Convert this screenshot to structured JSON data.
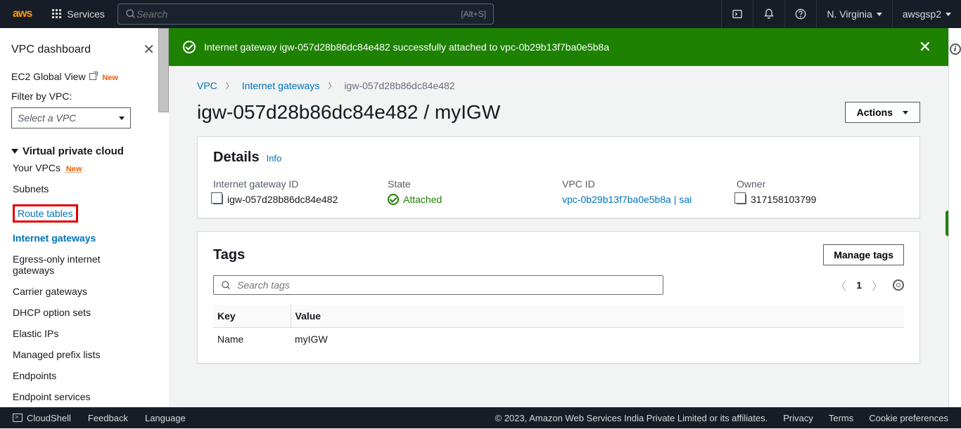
{
  "topnav": {
    "logo": "aws",
    "services": "Services",
    "search_placeholder": "Search",
    "search_hint": "[Alt+S]",
    "region": "N. Virginia",
    "account": "awsgsp2"
  },
  "sidebar": {
    "dashboard": "VPC dashboard",
    "ec2global": "EC2 Global View",
    "new_badge": "New",
    "filter_label": "Filter by VPC:",
    "vpc_select_placeholder": "Select a VPC",
    "section": "Virtual private cloud",
    "items": [
      {
        "label": "Your VPCs",
        "new": true
      },
      {
        "label": "Subnets"
      },
      {
        "label": "Route tables",
        "highlighted": true,
        "boxed": true
      },
      {
        "label": "Internet gateways",
        "active": true
      },
      {
        "label": "Egress-only internet gateways"
      },
      {
        "label": "Carrier gateways"
      },
      {
        "label": "DHCP option sets"
      },
      {
        "label": "Elastic IPs"
      },
      {
        "label": "Managed prefix lists"
      },
      {
        "label": "Endpoints"
      },
      {
        "label": "Endpoint services"
      }
    ]
  },
  "flash": {
    "message": "Internet gateway igw-057d28b86dc84e482 successfully attached to vpc-0b29b13f7ba0e5b8a"
  },
  "breadcrumbs": {
    "vpc": "VPC",
    "igw": "Internet gateways",
    "current": "igw-057d28b86dc84e482"
  },
  "page_title": "igw-057d28b86dc84e482 / myIGW",
  "actions_btn": "Actions",
  "details": {
    "title": "Details",
    "info": "Info",
    "igw_id_label": "Internet gateway ID",
    "igw_id": "igw-057d28b86dc84e482",
    "state_label": "State",
    "state": "Attached",
    "vpc_label": "VPC ID",
    "vpc": "vpc-0b29b13f7ba0e5b8a | sai",
    "owner_label": "Owner",
    "owner": "317158103799"
  },
  "tags": {
    "title": "Tags",
    "manage": "Manage tags",
    "search_placeholder": "Search tags",
    "page": "1",
    "key_h": "Key",
    "val_h": "Value",
    "rows": [
      {
        "key": "Name",
        "value": "myIGW"
      }
    ]
  },
  "footer": {
    "cloudshell": "CloudShell",
    "feedback": "Feedback",
    "language": "Language",
    "copyright": "© 2023, Amazon Web Services India Private Limited or its affiliates.",
    "privacy": "Privacy",
    "terms": "Terms",
    "cookies": "Cookie preferences"
  }
}
